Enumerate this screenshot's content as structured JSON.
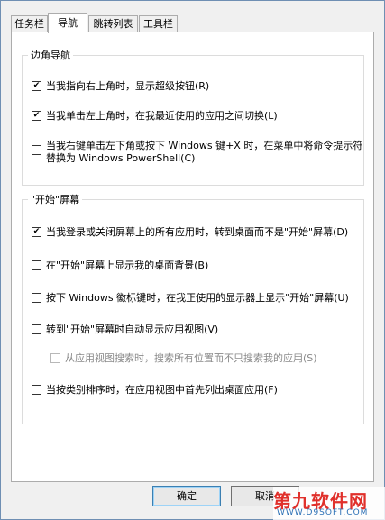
{
  "tabs": [
    "任务栏",
    "导航",
    "跳转列表",
    "工具栏"
  ],
  "corner_nav": {
    "title": "边角导航",
    "items": [
      {
        "label": "当我指向右上角时，显示超级按钮(R)",
        "checked": true
      },
      {
        "label": "当我单击左上角时，在我最近使用的应用之间切换(L)",
        "checked": true
      },
      {
        "label_line1": "当我右键单击左下角或按下 Windows 键+X 时，在菜单中将命令提示符",
        "label_line2": "替换为 Windows PowerShell(C)",
        "checked": false
      }
    ]
  },
  "start_screen": {
    "title": "\"开始\"屏幕",
    "items": [
      {
        "label": "当我登录或关闭屏幕上的所有应用时，转到桌面而不是\"开始\"屏幕(D)",
        "checked": true
      },
      {
        "label": "在\"开始\"屏幕上显示我的桌面背景(B)",
        "checked": false
      },
      {
        "label": "按下 Windows 徽标键时，在我正使用的显示器上显示\"开始\"屏幕(U)",
        "checked": false
      },
      {
        "label": "转到\"开始\"屏幕时自动显示应用视图(V)",
        "checked": false
      },
      {
        "label": "从应用视图搜索时，搜索所有位置而不只搜索我的应用(S)",
        "checked": false,
        "disabled": true
      },
      {
        "label": "当按类别排序时，在应用视图中首先列出桌面应用(F)",
        "checked": false
      }
    ]
  },
  "buttons": {
    "ok": "确定",
    "cancel": "取消"
  },
  "watermark": {
    "main": "第九软件网",
    "sub": "WWW.D9SOFT.COM"
  }
}
